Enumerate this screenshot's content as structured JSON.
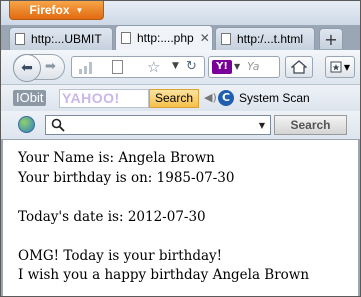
{
  "browser": {
    "menu_button": "Firefox",
    "tabs": [
      {
        "label": "http:...UBMIT",
        "active": false
      },
      {
        "label": "http:....php",
        "active": true
      },
      {
        "label": "http:/...t.html",
        "active": false
      }
    ],
    "new_tab": "+",
    "search_placeholder": "Ya",
    "search_engine": "Y!"
  },
  "iobit_toolbar": {
    "logo": "IObit",
    "search_field_brand": "YAHOO!",
    "search_button": "Search",
    "system_scan": "System Scan"
  },
  "find_bar": {
    "button": "Search"
  },
  "page": {
    "lines": [
      "Your Name is: Angela Brown",
      "Your birthday is on: 1985-07-30",
      "Today's date is: 2012-07-30",
      "OMG! Today is your birthday!",
      "I wish you a happy birthday Angela Brown"
    ]
  },
  "colors": {
    "firefox_button": "#e8801e",
    "chrome": "#dde5ee",
    "page_bg": "#ffffff"
  }
}
